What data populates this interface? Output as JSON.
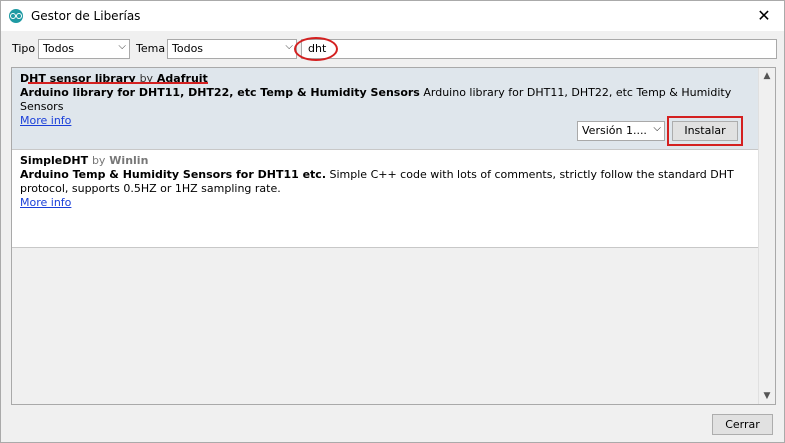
{
  "window": {
    "title": "Gestor de Liberías",
    "close_glyph": "✕"
  },
  "filters": {
    "type_label": "Tipo",
    "type_value": "Todos",
    "topic_label": "Tema",
    "topic_value": "Todos",
    "search_value": "dht"
  },
  "results": [
    {
      "name": "DHT sensor library",
      "by": "by",
      "author": "Adafruit",
      "description_bold": "Arduino library for DHT11, DHT22, etc Temp & Humidity Sensors",
      "description_text": " Arduino library for DHT11, DHT22, etc Temp & Humidity Sensors",
      "more_info": "More info",
      "version_label": "Versión 1....",
      "install_label": "Instalar"
    },
    {
      "name": "SimpleDHT",
      "by": "by",
      "author": "Winlin",
      "description_bold": "Arduino Temp & Humidity Sensors for DHT11 etc.",
      "description_text": " Simple C++ code with lots of comments, strictly follow the standard DHT protocol, supports 0.5HZ or 1HZ sampling rate.",
      "more_info": "More info"
    }
  ],
  "footer": {
    "close_label": "Cerrar"
  },
  "icons": {
    "chevron_down": "⌵",
    "scroll_up": "▲",
    "scroll_down": "▼"
  },
  "colors": {
    "annotation_red": "#d42020",
    "link_blue": "#1a3fd9",
    "selected_row": "#dfe6ec"
  }
}
